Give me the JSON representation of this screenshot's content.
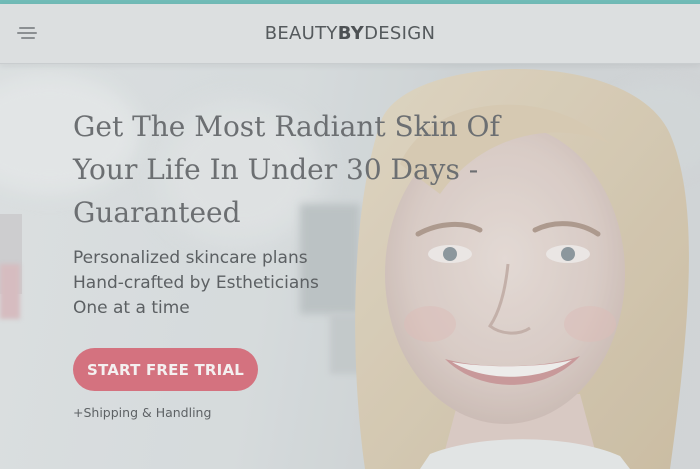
{
  "header": {
    "menu_icon": "hamburger-menu-icon",
    "brand_part1": "BEAUTY",
    "brand_part2": "BY",
    "brand_part3": "DESIGN"
  },
  "hero": {
    "headline": "Get The Most Radiant Skin Of Your Life In Under 30 Days - Guaranteed",
    "subcopy": [
      "Personalized skincare plans",
      "Hand-crafted by Estheticians",
      "One at a time"
    ],
    "cta_label": "START FREE TRIAL",
    "shipping_note": "+Shipping & Handling"
  },
  "colors": {
    "accent": "#5fb8b2",
    "cta": "#d4727f"
  }
}
